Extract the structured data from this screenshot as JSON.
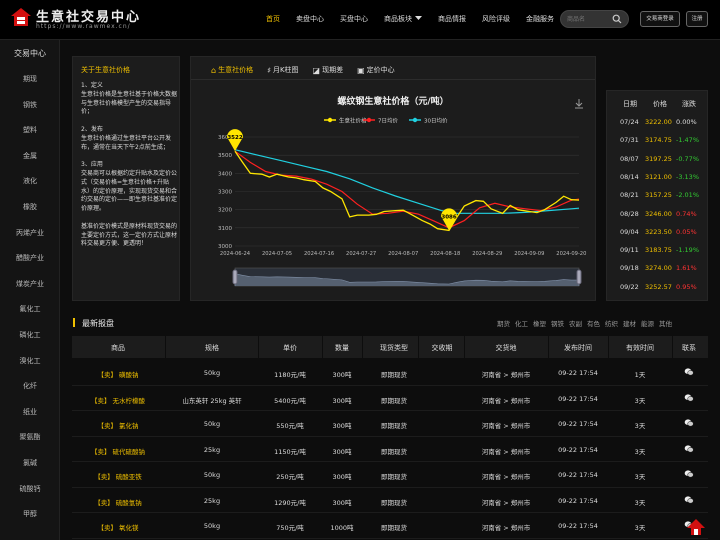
{
  "header": {
    "brand": "生意社交易中心",
    "url": "https://www.rawmex.cn/",
    "nav": [
      {
        "label": "首页",
        "active": true
      },
      {
        "label": "卖盘中心"
      },
      {
        "label": "买盘中心"
      },
      {
        "label": "商品板块"
      },
      {
        "label": "商品情报"
      },
      {
        "label": "风险评级"
      },
      {
        "label": "金融服务"
      }
    ],
    "search_placeholder": "商品名",
    "login_label": "交易商登录",
    "register_label": "注册"
  },
  "sidebar": {
    "title": "交易中心",
    "items": [
      "期现",
      "钢铁",
      "塑料",
      "金属",
      "液化",
      "橡胶",
      "丙烯产业",
      "醋酸产业",
      "煤炭产业",
      "氟化工",
      "磷化工",
      "溴化工",
      "化纤",
      "纸业",
      "聚氨酯",
      "氯碱",
      "硫酸钙",
      "甲醇"
    ]
  },
  "intro": {
    "title": "关于生意社价格",
    "text": "1、定义\n生意社价格是生意社基于价格大数据与生意社价格模型产生的交易指导价；\n\n2、发布\n生意社价格通过生意社平台公开发布，通常在当天下午2点前生成；\n\n3、应用\n交易商可以根据约定升贴水及定价公式（交易价格=生意社价格+升贴水）的定价原理，实现现货交易和合约交易的定价——即生意社基准价定价原理。\n\n基准价定价模式是原材料现货交易的主要定价方式，这一定价方式让原材料交易更方便、更透明！"
  },
  "tabs": [
    {
      "label": "生意社价格",
      "icon": "home-icon",
      "active": true
    },
    {
      "label": "月K柱图",
      "icon": "kline-icon"
    },
    {
      "label": "现期差",
      "icon": "area-chart-icon"
    },
    {
      "label": "定价中心",
      "icon": "pricing-icon"
    }
  ],
  "chart_data": {
    "type": "line",
    "title": "螺纹钢生意社价格（元/吨）",
    "legend": [
      "生意社价格",
      "7日均价",
      "30日均价"
    ],
    "legend_position": "top",
    "ylim": [
      3000,
      3600
    ],
    "yticks": [
      3000,
      3100,
      3200,
      3300,
      3400,
      3500,
      3600
    ],
    "xticks": [
      "2024-06-24",
      "2024-07-05",
      "2024-07-16",
      "2024-07-27",
      "2024-08-07",
      "2024-08-18",
      "2024-08-29",
      "2024-09-09",
      "2024-09-20"
    ],
    "x_range": [
      "2024-06-24",
      "2024-09-22"
    ],
    "markers": [
      {
        "series": "生意社价格",
        "date": "2024-06-24",
        "value": 3522
      },
      {
        "series": "生意社价格",
        "date": "2024-08-19",
        "value": 3086
      }
    ],
    "series": [
      {
        "name": "生意社价格",
        "color": "#ffe600",
        "points": [
          [
            "2024-06-24",
            3522
          ],
          [
            "2024-06-26",
            3460
          ],
          [
            "2024-06-28",
            3400
          ],
          [
            "2024-07-01",
            3395
          ],
          [
            "2024-07-03",
            3380
          ],
          [
            "2024-07-05",
            3395
          ],
          [
            "2024-07-08",
            3380
          ],
          [
            "2024-07-10",
            3375
          ],
          [
            "2024-07-12",
            3365
          ],
          [
            "2024-07-15",
            3355
          ],
          [
            "2024-07-17",
            3320
          ],
          [
            "2024-07-19",
            3300
          ],
          [
            "2024-07-22",
            3260
          ],
          [
            "2024-07-24",
            3160
          ],
          [
            "2024-07-26",
            3170
          ],
          [
            "2024-07-29",
            3170
          ],
          [
            "2024-07-31",
            3174.75
          ],
          [
            "2024-08-02",
            3190
          ],
          [
            "2024-08-05",
            3195
          ],
          [
            "2024-08-07",
            3197.25
          ],
          [
            "2024-08-09",
            3175
          ],
          [
            "2024-08-12",
            3140
          ],
          [
            "2024-08-14",
            3121
          ],
          [
            "2024-08-16",
            3095
          ],
          [
            "2024-08-19",
            3086
          ],
          [
            "2024-08-21",
            3157.25
          ],
          [
            "2024-08-23",
            3220
          ],
          [
            "2024-08-26",
            3250
          ],
          [
            "2024-08-28",
            3246
          ],
          [
            "2024-08-30",
            3205
          ],
          [
            "2024-09-02",
            3180
          ],
          [
            "2024-09-04",
            3223.5
          ],
          [
            "2024-09-06",
            3200
          ],
          [
            "2024-09-09",
            3190
          ],
          [
            "2024-09-11",
            3183.75
          ],
          [
            "2024-09-13",
            3200
          ],
          [
            "2024-09-16",
            3240
          ],
          [
            "2024-09-18",
            3274
          ],
          [
            "2024-09-20",
            3255
          ],
          [
            "2024-09-22",
            3252.57
          ]
        ]
      },
      {
        "name": "7日均价",
        "color": "#ff2020",
        "points": [
          [
            "2024-06-24",
            3522
          ],
          [
            "2024-06-28",
            3460
          ],
          [
            "2024-07-02",
            3410
          ],
          [
            "2024-07-06",
            3390
          ],
          [
            "2024-07-10",
            3385
          ],
          [
            "2024-07-14",
            3368
          ],
          [
            "2024-07-18",
            3340
          ],
          [
            "2024-07-22",
            3300
          ],
          [
            "2024-07-26",
            3230
          ],
          [
            "2024-07-30",
            3175
          ],
          [
            "2024-08-03",
            3180
          ],
          [
            "2024-08-07",
            3192
          ],
          [
            "2024-08-11",
            3175
          ],
          [
            "2024-08-15",
            3138
          ],
          [
            "2024-08-19",
            3100
          ],
          [
            "2024-08-23",
            3140
          ],
          [
            "2024-08-27",
            3210
          ],
          [
            "2024-08-31",
            3235
          ],
          [
            "2024-09-04",
            3215
          ],
          [
            "2024-09-08",
            3205
          ],
          [
            "2024-09-12",
            3195
          ],
          [
            "2024-09-16",
            3215
          ],
          [
            "2024-09-20",
            3252
          ],
          [
            "2024-09-22",
            3258
          ]
        ]
      },
      {
        "name": "30日均价",
        "color": "#20d0e0",
        "points": [
          [
            "2024-06-24",
            3530
          ],
          [
            "2024-06-30",
            3500
          ],
          [
            "2024-07-06",
            3470
          ],
          [
            "2024-07-12",
            3440
          ],
          [
            "2024-07-18",
            3410
          ],
          [
            "2024-07-24",
            3370
          ],
          [
            "2024-07-30",
            3320
          ],
          [
            "2024-08-05",
            3275
          ],
          [
            "2024-08-11",
            3235
          ],
          [
            "2024-08-17",
            3195
          ],
          [
            "2024-08-21",
            3180
          ],
          [
            "2024-08-27",
            3180
          ],
          [
            "2024-09-02",
            3180
          ],
          [
            "2024-09-08",
            3185
          ],
          [
            "2024-09-14",
            3195
          ],
          [
            "2024-09-20",
            3205
          ],
          [
            "2024-09-22",
            3208
          ]
        ]
      }
    ]
  },
  "side_table": {
    "headers": [
      "日期",
      "价格",
      "涨跌"
    ],
    "rows": [
      {
        "date": "07/24",
        "price": "3222.00",
        "change": "0.00%",
        "dir": "flat"
      },
      {
        "date": "07/31",
        "price": "3174.75",
        "change": "-1.47%",
        "dir": "down"
      },
      {
        "date": "08/07",
        "price": "3197.25",
        "change": "-0.77%",
        "dir": "down"
      },
      {
        "date": "08/14",
        "price": "3121.00",
        "change": "-3.13%",
        "dir": "down"
      },
      {
        "date": "08/21",
        "price": "3157.25",
        "change": "-2.01%",
        "dir": "down"
      },
      {
        "date": "08/28",
        "price": "3246.00",
        "change": "0.74%",
        "dir": "up"
      },
      {
        "date": "09/04",
        "price": "3223.50",
        "change": "0.05%",
        "dir": "up"
      },
      {
        "date": "09/11",
        "price": "3183.75",
        "change": "-1.19%",
        "dir": "down"
      },
      {
        "date": "09/18",
        "price": "3274.00",
        "change": "1.61%",
        "dir": "up"
      },
      {
        "date": "09/22",
        "price": "3252.57",
        "change": "0.95%",
        "dir": "up"
      }
    ]
  },
  "quotes": {
    "title": "最新报盘",
    "filters": [
      "期货",
      "化工",
      "橡塑",
      "钢铁",
      "农副",
      "有色",
      "纺织",
      "建材",
      "能源",
      "其他"
    ],
    "headers": [
      "商品",
      "规格",
      "单价",
      "数量",
      "现货类型",
      "交收期",
      "交货地",
      "发布时间",
      "有效时间",
      "联系"
    ],
    "rows": [
      {
        "name": "【卖】 磺酸钠",
        "spec": "50kg",
        "price": "1180元/吨",
        "qty": "300吨",
        "type": "即期现货",
        "delivery": "",
        "place": "河南省 > 郑州市",
        "time": "09-22 17:54",
        "valid": "1天"
      },
      {
        "name": "【卖】 无水柠檬酸",
        "spec": "山东英轩 25kg 英轩",
        "price": "5400元/吨",
        "qty": "300吨",
        "type": "即期现货",
        "delivery": "",
        "place": "河南省 > 郑州市",
        "time": "09-22 17:54",
        "valid": "3天"
      },
      {
        "name": "【卖】 氯化钠",
        "spec": "50kg",
        "price": "550元/吨",
        "qty": "300吨",
        "type": "即期现货",
        "delivery": "",
        "place": "河南省 > 郑州市",
        "time": "09-22 17:54",
        "valid": "3天"
      },
      {
        "name": "【卖】 硫代硫酸钠",
        "spec": "25kg",
        "price": "1150元/吨",
        "qty": "300吨",
        "type": "即期现货",
        "delivery": "",
        "place": "河南省 > 郑州市",
        "time": "09-22 17:54",
        "valid": "3天"
      },
      {
        "name": "【卖】 硫酸亚铁",
        "spec": "50kg",
        "price": "250元/吨",
        "qty": "300吨",
        "type": "即期现货",
        "delivery": "",
        "place": "河南省 > 郑州市",
        "time": "09-22 17:54",
        "valid": "3天"
      },
      {
        "name": "【卖】 硫酸氢钠",
        "spec": "25kg",
        "price": "1290元/吨",
        "qty": "300吨",
        "type": "即期现货",
        "delivery": "",
        "place": "河南省 > 郑州市",
        "time": "09-22 17:54",
        "valid": "3天"
      },
      {
        "name": "【卖】 氧化镁",
        "spec": "50kg",
        "price": "750元/吨",
        "qty": "1000吨",
        "type": "即期现货",
        "delivery": "",
        "place": "河南省 > 郑州市",
        "time": "09-22 17:54",
        "valid": "3天"
      }
    ]
  },
  "colors": {
    "accent": "#f0c000",
    "up": "#ff3333",
    "down": "#33cc33",
    "bg": "#0d0d0d",
    "panel": "#1c1c1c"
  }
}
